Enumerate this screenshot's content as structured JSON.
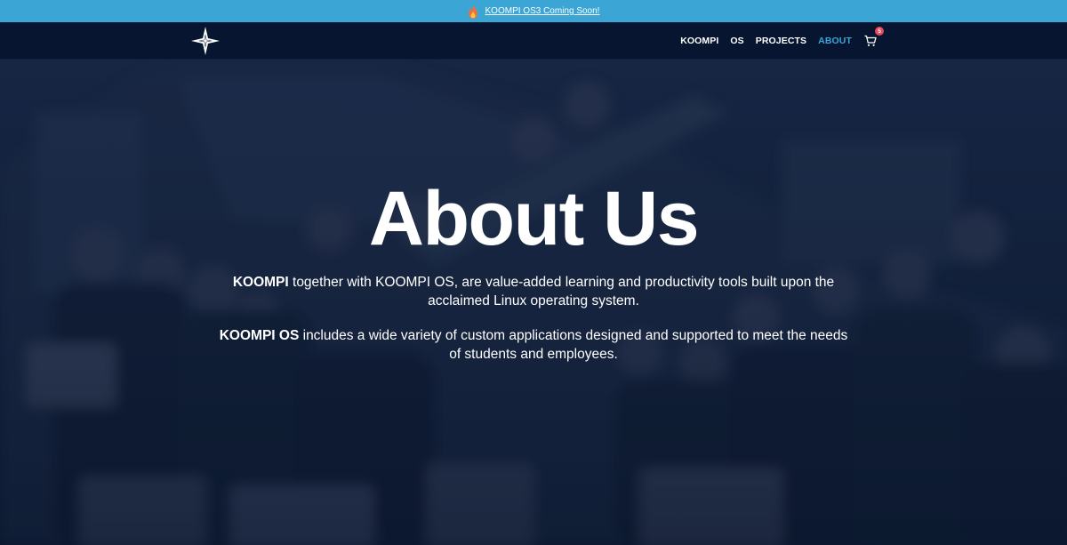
{
  "announcement": {
    "icon": "flame-icon",
    "text": "KOOMPI OS3 Coming Soon!"
  },
  "nav": {
    "logo": "koompi-star-logo",
    "items": [
      {
        "label": "KOOMPI",
        "active": false
      },
      {
        "label": "OS",
        "active": false
      },
      {
        "label": "PROJECTS",
        "active": false
      },
      {
        "label": "ABOUT",
        "active": true
      }
    ],
    "cart": {
      "icon": "cart-icon",
      "count": "5"
    }
  },
  "hero": {
    "title": "About Us",
    "paragraph1": {
      "bold": "KOOMPI",
      "text": " together with KOOMPI OS, are value-added learning and productivity tools built upon the acclaimed Linux operating system."
    },
    "paragraph2": {
      "bold": "KOOMPI OS",
      "text": " includes a wide variety of custom applications designed and supported to meet the needs of students and employees."
    }
  },
  "colors": {
    "accent": "#3ba6d6",
    "nav_bg": "#071530",
    "badge": "#e64a5c"
  }
}
